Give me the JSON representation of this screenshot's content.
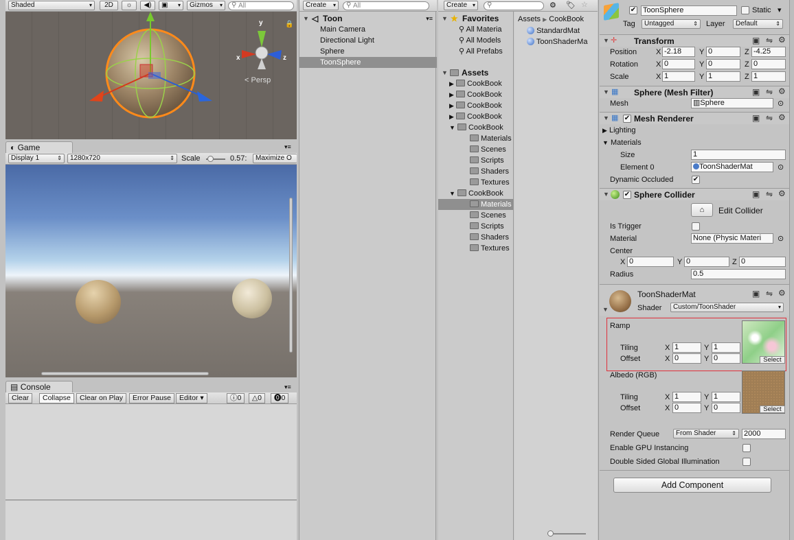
{
  "scene": {
    "shading": "Shaded",
    "mode2d": "2D",
    "gizmos": "Gizmos",
    "search_placeholder": "All",
    "persp": "Persp",
    "axes": {
      "y": "y",
      "x": "x",
      "z": "z"
    }
  },
  "game": {
    "tab": "Game",
    "display": "Display 1",
    "resolution": "1280x720",
    "scale_label": "Scale",
    "scale_value": "0.57:",
    "maximize": "Maximize O"
  },
  "console": {
    "tab": "Console",
    "buttons": [
      "Clear",
      "Collapse",
      "Clear on Play",
      "Error Pause",
      "Editor"
    ],
    "counts": {
      "log": "0",
      "warn": "0",
      "error": "0"
    }
  },
  "hierarchy": {
    "create": "Create",
    "search_placeholder": "All",
    "scene_name": "Toon",
    "items": [
      "Main Camera",
      "Directional Light",
      "Sphere",
      "ToonSphere"
    ]
  },
  "project": {
    "create": "Create",
    "favorites": {
      "label": "Favorites",
      "items": [
        "All Materia",
        "All Models",
        "All Prefabs"
      ]
    },
    "assets": {
      "label": "Assets",
      "folders": [
        "CookBook",
        "CookBook",
        "CookBook",
        "CookBook",
        "CookBook",
        "CookBook"
      ],
      "cookbook6_children": [
        "Materials",
        "Scenes",
        "Scripts",
        "Shaders",
        "Textures"
      ],
      "cookbook7_children": [
        "Materials",
        "Scenes",
        "Scripts",
        "Shaders",
        "Textures"
      ]
    },
    "breadcrumb": [
      "Assets",
      "CookBook"
    ],
    "files": [
      "StandardMat",
      "ToonShaderMa"
    ]
  },
  "inspector": {
    "object_name": "ToonSphere",
    "static_label": "Static",
    "tag_label": "Tag",
    "tag_value": "Untagged",
    "layer_label": "Layer",
    "layer_value": "Default",
    "transform": {
      "title": "Transform",
      "position": {
        "label": "Position",
        "x": "-2.18",
        "y": "0",
        "z": "-4.25"
      },
      "rotation": {
        "label": "Rotation",
        "x": "0",
        "y": "0",
        "z": "0"
      },
      "scale": {
        "label": "Scale",
        "x": "1",
        "y": "1",
        "z": "1"
      }
    },
    "mesh_filter": {
      "title": "Sphere (Mesh Filter)",
      "mesh_label": "Mesh",
      "mesh_value": "Sphere"
    },
    "mesh_renderer": {
      "title": "Mesh Renderer",
      "lighting": "Lighting",
      "materials": "Materials",
      "size_label": "Size",
      "size_value": "1",
      "element0_label": "Element 0",
      "element0_value": "ToonShaderMat",
      "dynamic_occluded": "Dynamic Occluded"
    },
    "sphere_collider": {
      "title": "Sphere Collider",
      "edit_collider": "Edit Collider",
      "is_trigger": "Is Trigger",
      "material_label": "Material",
      "material_value": "None (Physic Materi",
      "center_label": "Center",
      "center": {
        "x": "0",
        "y": "0",
        "z": "0"
      },
      "radius_label": "Radius",
      "radius_value": "0.5"
    },
    "material": {
      "name": "ToonShaderMat",
      "shader_label": "Shader",
      "shader_value": "Custom/ToonShader",
      "ramp": {
        "label": "Ramp",
        "tiling_label": "Tiling",
        "tiling_x": "1",
        "tiling_y": "1",
        "offset_label": "Offset",
        "offset_x": "0",
        "offset_y": "0",
        "select": "Select"
      },
      "albedo": {
        "label": "Albedo (RGB)",
        "tiling_label": "Tiling",
        "tiling_x": "1",
        "tiling_y": "1",
        "offset_label": "Offset",
        "offset_x": "0",
        "offset_y": "0",
        "select": "Select"
      },
      "render_queue_label": "Render Queue",
      "render_queue_mode": "From Shader",
      "render_queue_value": "2000",
      "gpu_instancing": "Enable GPU Instancing",
      "double_sided_gi": "Double Sided Global Illumination"
    },
    "add_component": "Add Component"
  },
  "xyz": {
    "x": "X",
    "y": "Y",
    "z": "Z"
  }
}
